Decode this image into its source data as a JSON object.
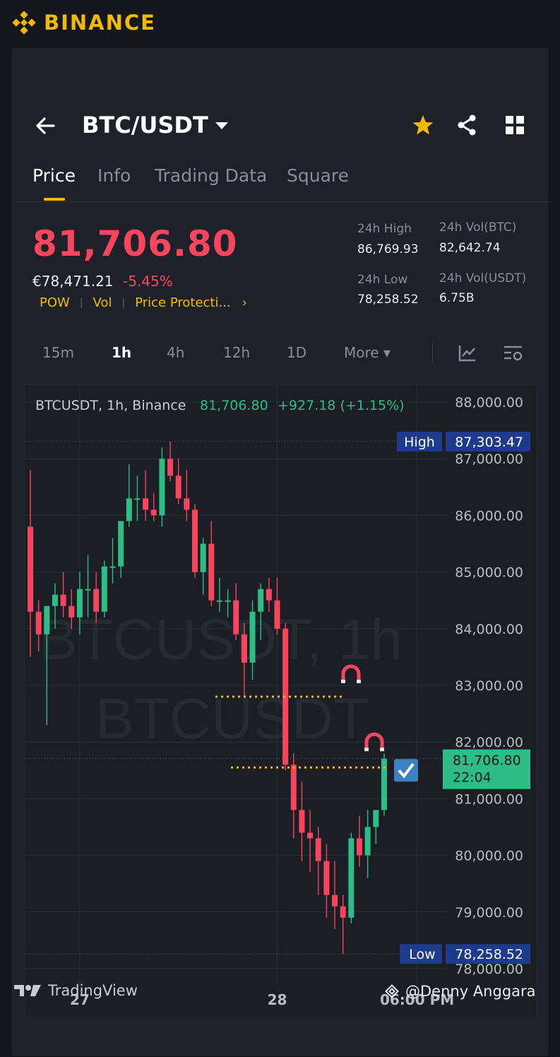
{
  "brand": {
    "name": "BINANCE",
    "logo_icon": "binance-diamond-logo",
    "color": "#f0b90b"
  },
  "header": {
    "pair": "BTC/USDT",
    "icons": [
      "back-arrow-icon",
      "chevron-down-icon",
      "star-icon",
      "share-icon",
      "grid-icon"
    ]
  },
  "tabs": [
    {
      "label": "Price",
      "active": true
    },
    {
      "label": "Info",
      "active": false
    },
    {
      "label": "Trading Data",
      "active": false
    },
    {
      "label": "Square",
      "active": false
    }
  ],
  "ticker": {
    "last_price": "81,706.80",
    "eur_price": "€78,471.21",
    "change_pct": "-5.45%",
    "tags": [
      "POW",
      "Vol",
      "Price Protecti..."
    ],
    "tags_chevron": "›",
    "high_label": "24h High",
    "high_value": "86,769.93",
    "vol_btc_label": "24h Vol(BTC)",
    "vol_btc_value": "82,642.74",
    "low_label": "24h Low",
    "low_value": "78,258.52",
    "vol_usdt_label": "24h Vol(USDT)",
    "vol_usdt_value": "6.75B"
  },
  "intervals": {
    "items": [
      {
        "label": "15m",
        "active": false
      },
      {
        "label": "1h",
        "active": true
      },
      {
        "label": "4h",
        "active": false
      },
      {
        "label": "12h",
        "active": false
      },
      {
        "label": "1D",
        "active": false
      },
      {
        "label": "More ▾",
        "active": false
      }
    ],
    "icons": [
      "indicator-icon",
      "chart-settings-icon"
    ]
  },
  "chart_data": {
    "type": "candlestick",
    "legend_symbol": "BTCUSDT, 1h, Binance",
    "legend_price": "81,706.80",
    "legend_change": "+927.18 (+1.15%)",
    "watermark_line1": "BTCUSDT, 1h",
    "watermark_line2": "BTCUSDT",
    "y_ticks": [
      "88,000.00",
      "87,000.00",
      "86,000.00",
      "85,000.00",
      "84,000.00",
      "83,000.00",
      "82,000.00",
      "81,000.00",
      "80,000.00",
      "79,000.00",
      "78,000.00"
    ],
    "ylim": [
      77700,
      88300
    ],
    "x_ticks": [
      "27",
      "28",
      "06:00 PM"
    ],
    "high_marker": {
      "label": "High",
      "value": "87,303.47"
    },
    "low_marker": {
      "label": "Low",
      "value": "78,258.52"
    },
    "last_marker": {
      "value": "81,706.80",
      "countdown": "22:04"
    },
    "alert_lines": [
      82800,
      81550
    ],
    "colors": {
      "up": "#2ebd85",
      "down": "#f6465d",
      "grid": "#2a2e36",
      "axis_text": "#b7bdc6"
    },
    "candles": [
      [
        85800,
        86800,
        83500,
        84300
      ],
      [
        84300,
        84500,
        83600,
        83900
      ],
      [
        83900,
        84400,
        82300,
        84400
      ],
      [
        84400,
        84800,
        84000,
        84600
      ],
      [
        84600,
        85000,
        84200,
        84400
      ],
      [
        84400,
        84700,
        84000,
        84200
      ],
      [
        84200,
        85000,
        83900,
        84700
      ],
      [
        84700,
        85300,
        84200,
        84700
      ],
      [
        84700,
        85000,
        84100,
        84300
      ],
      [
        84300,
        85200,
        84200,
        85100
      ],
      [
        85100,
        85600,
        84800,
        85100
      ],
      [
        85100,
        85900,
        84900,
        85900
      ],
      [
        85900,
        86900,
        85800,
        86300
      ],
      [
        86300,
        86700,
        85900,
        86300
      ],
      [
        86300,
        86800,
        85900,
        86100
      ],
      [
        86100,
        86400,
        85900,
        86000
      ],
      [
        86000,
        87200,
        85800,
        87000
      ],
      [
        87000,
        87303,
        86600,
        86700
      ],
      [
        86700,
        87000,
        86200,
        86300
      ],
      [
        86300,
        86800,
        85900,
        86100
      ],
      [
        86100,
        86200,
        84900,
        85000
      ],
      [
        85000,
        85600,
        84600,
        85500
      ],
      [
        85500,
        85900,
        84400,
        84500
      ],
      [
        84500,
        84900,
        84300,
        84500
      ],
      [
        84500,
        84700,
        84200,
        84500
      ],
      [
        84500,
        84800,
        83800,
        83900
      ],
      [
        83900,
        84100,
        82800,
        83400
      ],
      [
        83400,
        84500,
        83100,
        84300
      ],
      [
        84300,
        84800,
        83800,
        84700
      ],
      [
        84700,
        84900,
        84300,
        84500
      ],
      [
        84500,
        84900,
        83900,
        84000
      ],
      [
        84000,
        84100,
        81500,
        81600
      ],
      [
        81600,
        81800,
        80300,
        80800
      ],
      [
        80800,
        81300,
        79900,
        80400
      ],
      [
        80400,
        80800,
        79700,
        80300
      ],
      [
        80300,
        80500,
        79300,
        79900
      ],
      [
        79900,
        80200,
        78900,
        79300
      ],
      [
        79300,
        79900,
        78700,
        79100
      ],
      [
        79100,
        79300,
        78258,
        78900
      ],
      [
        78900,
        80400,
        78800,
        80300
      ],
      [
        80300,
        80700,
        79800,
        80000
      ],
      [
        80000,
        80800,
        79600,
        80500
      ],
      [
        80500,
        80800,
        80200,
        80800
      ],
      [
        80800,
        81800,
        80700,
        81706.8
      ]
    ]
  },
  "footer": {
    "tradingview_label": "TradingView",
    "user_label": "@Denny Anggara"
  }
}
